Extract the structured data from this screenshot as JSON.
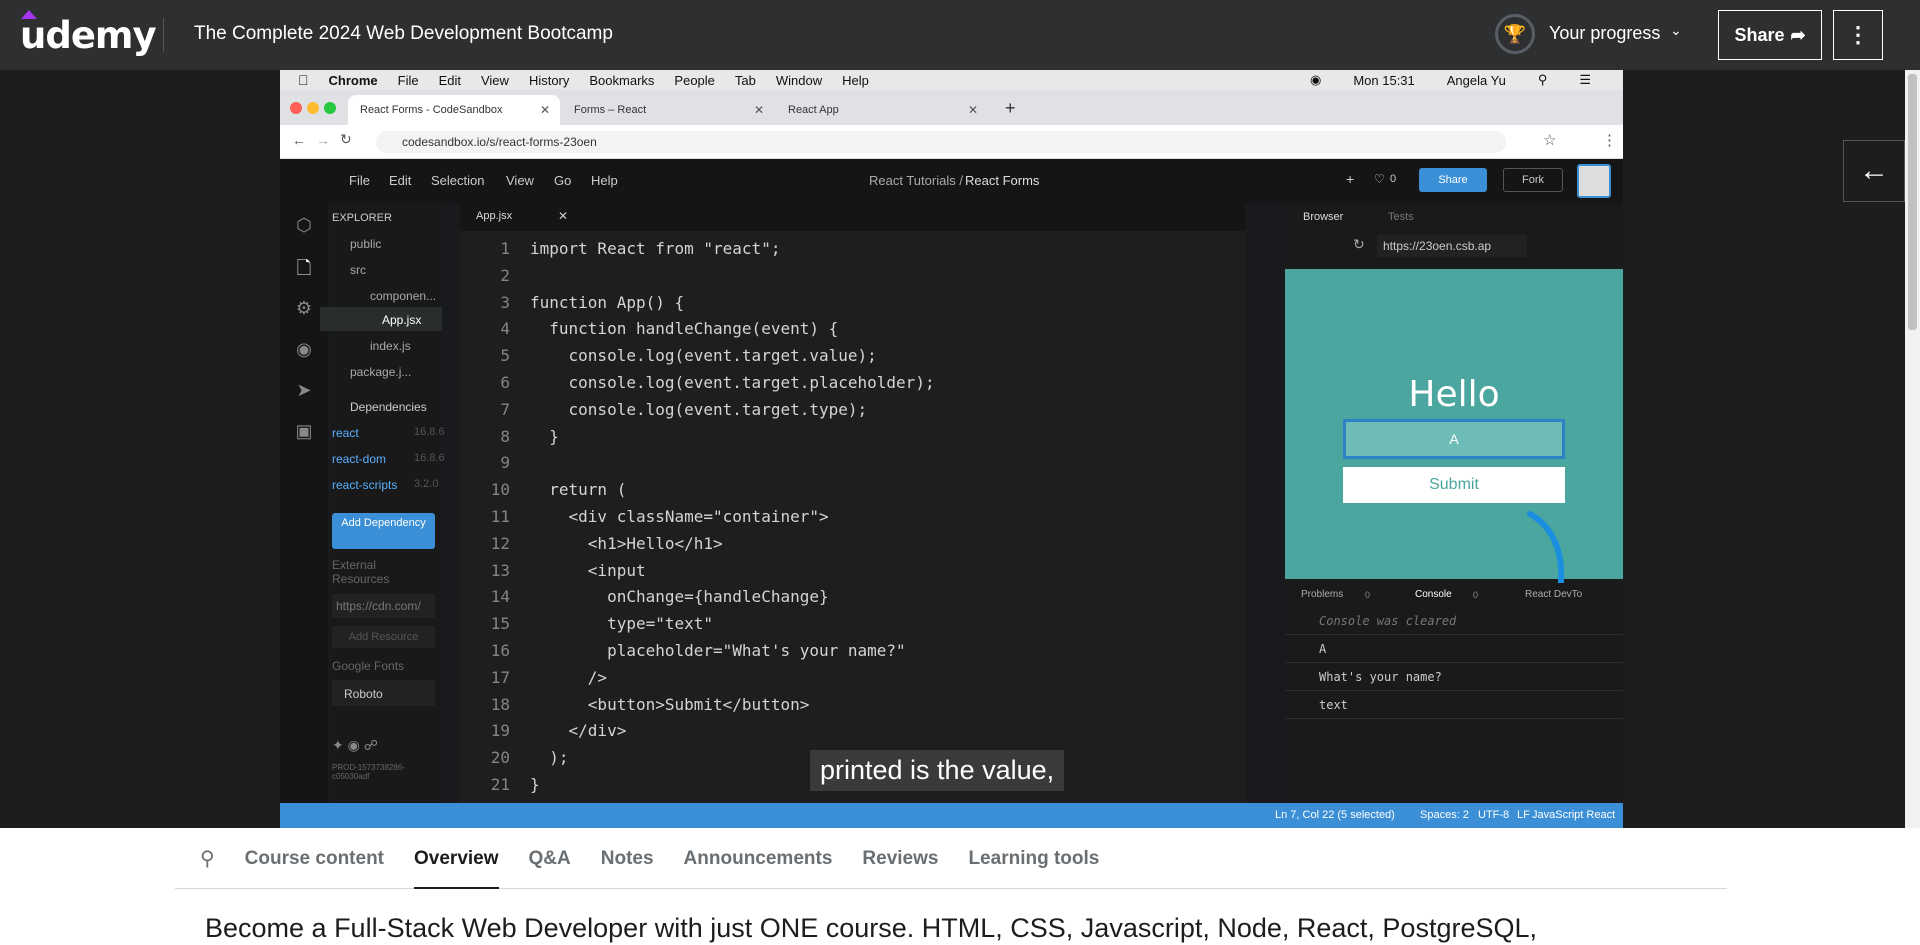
{
  "header": {
    "logo": "udemy",
    "course_title": "The Complete 2024 Web Development Bootcamp",
    "progress_label": "Your progress",
    "share_label": "Share",
    "more_icon": "vertical-dots-icon"
  },
  "mac_menu": {
    "items": [
      "Chrome",
      "File",
      "Edit",
      "View",
      "History",
      "Bookmarks",
      "People",
      "Tab",
      "Window",
      "Help"
    ],
    "clock": "Mon 15:31",
    "user": "Angela Yu"
  },
  "chrome": {
    "tabs": [
      {
        "label": "React Forms - CodeSandbox"
      },
      {
        "label": "Forms – React"
      },
      {
        "label": "React App"
      }
    ],
    "url": "codesandbox.io/s/react-forms-23oen"
  },
  "csb": {
    "menu": [
      "File",
      "Edit",
      "Selection",
      "View",
      "Go",
      "Help"
    ],
    "breadcrumb_parent": "React Tutorials / ",
    "breadcrumb_current": "React Forms",
    "likes": "0",
    "share_label": "Share",
    "fork_label": "Fork",
    "explorer_label": "EXPLORER",
    "files": [
      "public",
      "src",
      "componen...",
      "App.jsx",
      "index.js",
      "package.j..."
    ],
    "deps_label": "Dependencies",
    "deps": [
      {
        "name": "react",
        "version": "16.8.6"
      },
      {
        "name": "react-dom",
        "version": "16.8.6"
      },
      {
        "name": "react-scripts",
        "version": "3.2.0"
      }
    ],
    "add_dep_label": "Add Dependency",
    "external_label": "External Resources",
    "external_placeholder": "https://cdn.com/",
    "add_resource_label": "Add Resource",
    "google_fonts_label": "Google Fonts",
    "font_value": "Roboto",
    "build_id": "PROD-1573738286-c05030adf",
    "editor_tab": "App.jsx",
    "line_numbers": [
      "1",
      "2",
      "3",
      "4",
      "5",
      "6",
      "7",
      "8",
      "9",
      "10",
      "11",
      "12",
      "13",
      "14",
      "15",
      "16",
      "17",
      "18",
      "19",
      "20",
      "21"
    ],
    "code_lines": [
      "import React from \"react\";",
      "",
      "function App() {",
      "  function handleChange(event) {",
      "    console.log(event.target.value);",
      "    console.log(event.target.placeholder);",
      "    console.log(event.target.type);",
      "  }",
      "",
      "  return (",
      "    <div className=\"container\">",
      "      <h1>Hello</h1>",
      "      <input",
      "        onChange={handleChange}",
      "        type=\"text\"",
      "        placeholder=\"What's your name?\"",
      "      />",
      "      <button>Submit</button>",
      "    </div>",
      "  );",
      "}"
    ],
    "subtitle": "printed is the value,",
    "browser_tab": "Browser",
    "tests_tab": "Tests",
    "browser_url": "https://23oen.csb.ap",
    "preview_heading": "Hello",
    "preview_input_value": "A",
    "preview_submit": "Submit",
    "console_tabs": [
      "Problems",
      "Console",
      "React DevTo"
    ],
    "console_counts": [
      "0",
      "0"
    ],
    "console_lines": [
      "Console was cleared",
      "A",
      "What's your name?",
      "text"
    ],
    "status": {
      "position": "Ln 7, Col 22 (5 selected)",
      "spaces": "Spaces: 2",
      "encoding": "UTF-8",
      "eol": "LF",
      "language": "JavaScript React"
    }
  },
  "course_tabs": [
    "Course content",
    "Overview",
    "Q&A",
    "Notes",
    "Announcements",
    "Reviews",
    "Learning tools"
  ],
  "active_tab": "Overview",
  "description": "Become a Full-Stack Web Developer with just ONE course. HTML, CSS, Javascript, Node, React, PostgreSQL,",
  "colors": {
    "accent": "#a435f0",
    "header_bg": "#2d2f31",
    "csb_blue": "#3a8fd6",
    "preview_bg": "#4ca6a0"
  }
}
